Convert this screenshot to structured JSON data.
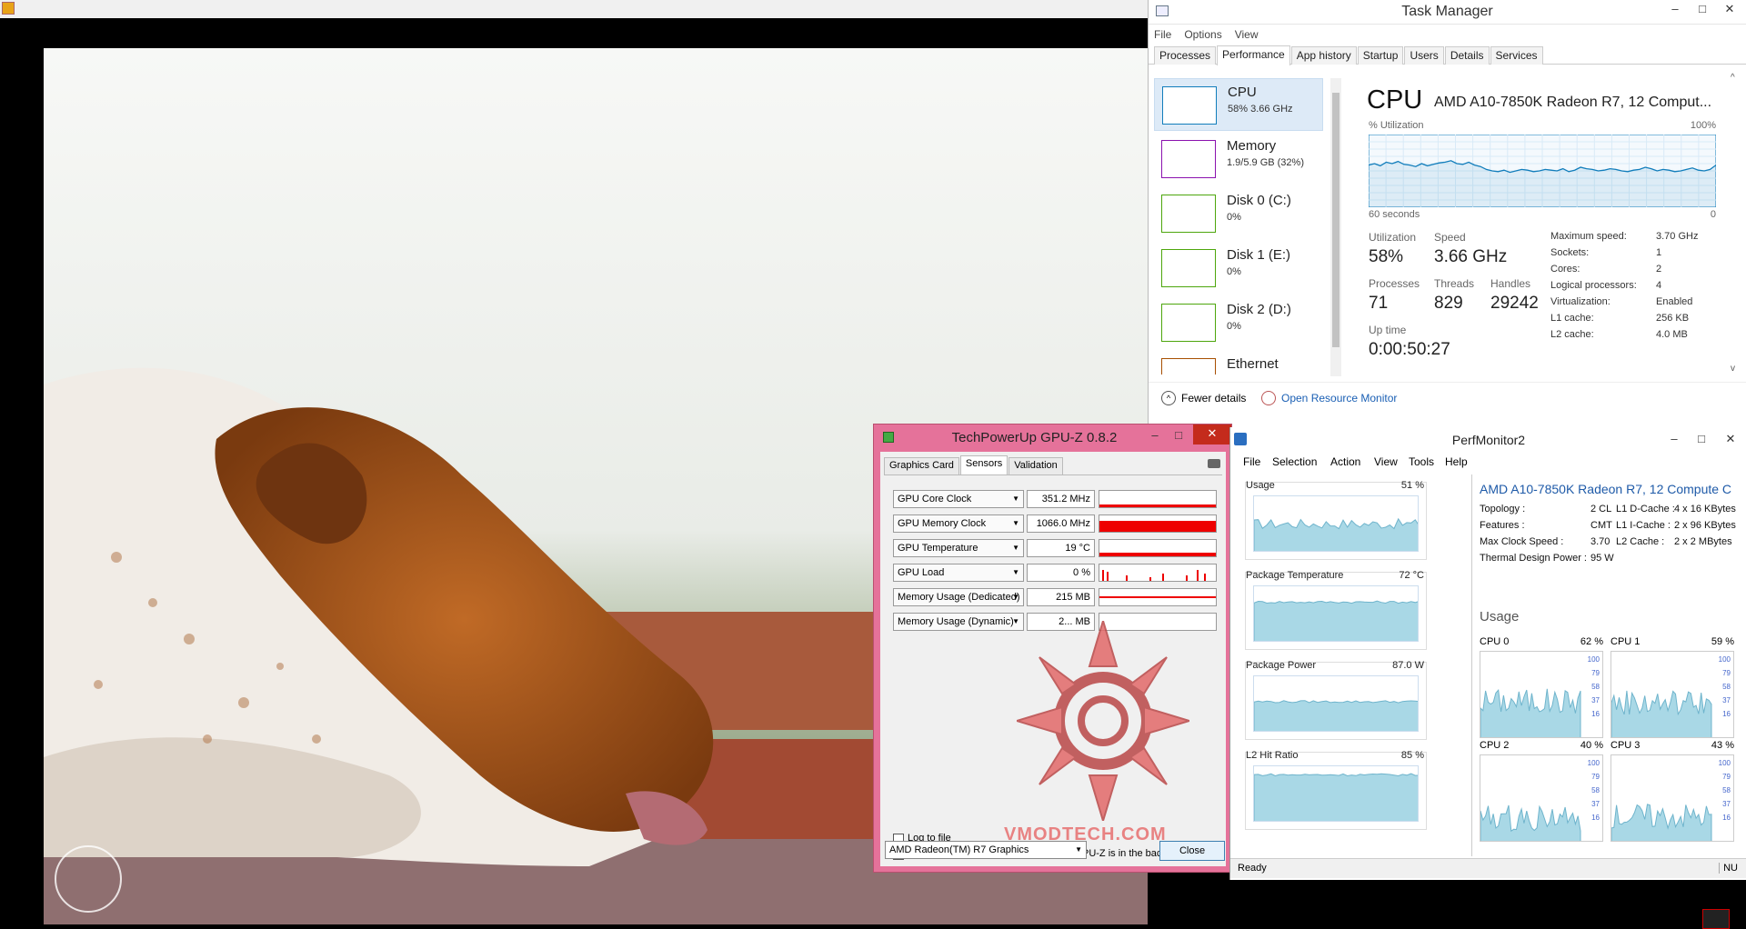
{
  "taskmgr": {
    "title": "Task Manager",
    "menu": [
      "File",
      "Options",
      "View"
    ],
    "tabs": [
      "Processes",
      "Performance",
      "App history",
      "Startup",
      "Users",
      "Details",
      "Services"
    ],
    "sidebar": [
      {
        "name": "CPU",
        "sub": "58%  3.66 GHz",
        "color": "#117dbb"
      },
      {
        "name": "Memory",
        "sub": "1.9/5.9 GB (32%)",
        "color": "#8b12ae"
      },
      {
        "name": "Disk 0 (C:)",
        "sub": "0%",
        "color": "#4da60c"
      },
      {
        "name": "Disk 1 (E:)",
        "sub": "0%",
        "color": "#4da60c"
      },
      {
        "name": "Disk 2 (D:)",
        "sub": "0%",
        "color": "#4da60c"
      },
      {
        "name": "Ethernet",
        "sub": "",
        "color": "#a74f01"
      }
    ],
    "cpu": {
      "heading": "CPU",
      "model": "AMD A10-7850K Radeon R7, 12 Comput...",
      "util_label": "% Utilization",
      "max_label": "100%",
      "seconds_label": "60 seconds",
      "zero_label": "0",
      "stats": {
        "utilization_label": "Utilization",
        "utilization": "58%",
        "speed_label": "Speed",
        "speed": "3.66 GHz",
        "processes_label": "Processes",
        "processes": "71",
        "threads_label": "Threads",
        "threads": "829",
        "handles_label": "Handles",
        "handles": "29242",
        "uptime_label": "Up time",
        "uptime": "0:00:50:27"
      },
      "specs": [
        {
          "k": "Maximum speed:",
          "v": "3.70 GHz"
        },
        {
          "k": "Sockets:",
          "v": "1"
        },
        {
          "k": "Cores:",
          "v": "2"
        },
        {
          "k": "Logical processors:",
          "v": "4"
        },
        {
          "k": "Virtualization:",
          "v": "Enabled"
        },
        {
          "k": "L1 cache:",
          "v": "256 KB"
        },
        {
          "k": "L2 cache:",
          "v": "4.0 MB"
        }
      ],
      "history": [
        58,
        60,
        57,
        62,
        60,
        63,
        59,
        58,
        56,
        60,
        57,
        59,
        61,
        62,
        64,
        60,
        59,
        62,
        58,
        56,
        52,
        50,
        49,
        51,
        48,
        50,
        52,
        51,
        49,
        50,
        52,
        51,
        50,
        53,
        49,
        51,
        55,
        53,
        52,
        50,
        51,
        53,
        52,
        50,
        49,
        51,
        52,
        55,
        53,
        50,
        52,
        51,
        49,
        50,
        52,
        54,
        51,
        50,
        52,
        58
      ]
    },
    "fewer_details": "Fewer details",
    "open_resmon": "Open Resource Monitor"
  },
  "gpuz": {
    "title": "TechPowerUp GPU-Z 0.8.2",
    "tabs": [
      "Graphics Card",
      "Sensors",
      "Validation"
    ],
    "sensors": [
      {
        "name": "GPU Core Clock",
        "value": "351.2 MHz"
      },
      {
        "name": "GPU Memory Clock",
        "value": "1066.0 MHz"
      },
      {
        "name": "GPU Temperature",
        "value": "19 °C"
      },
      {
        "name": "GPU Load",
        "value": "0 %"
      },
      {
        "name": "Memory Usage (Dedicated)",
        "value": "215 MB"
      },
      {
        "name": "Memory Usage (Dynamic)",
        "value": "2... MB"
      }
    ],
    "log_to_file": "Log to file",
    "continue_refresh": "Continue refreshing this screen while GPU-Z is in the background",
    "device": "AMD Radeon(TM) R7 Graphics",
    "close": "Close",
    "watermark": "VMODTECH.COM"
  },
  "perfmon": {
    "title": "PerfMonitor2",
    "menu": [
      "File",
      "Selection",
      "Action",
      "View",
      "Tools",
      "Help"
    ],
    "tiles": [
      {
        "label": "Usage",
        "value": "51 %",
        "level": 0.51
      },
      {
        "label": "Package Temperature",
        "value": "72 °C",
        "level": 0.72
      },
      {
        "label": "Package Power",
        "value": "87.0 W",
        "level": 0.55
      },
      {
        "label": "L2 Hit Ratio",
        "value": "85 %",
        "level": 0.85
      }
    ],
    "cpu_name": "AMD A10-7850K Radeon R7, 12 Compute C",
    "specs": [
      {
        "k": "Topology :",
        "v": "2 CL",
        "k2": "L1 D-Cache :",
        "v2": "4 x 16 KBytes"
      },
      {
        "k": "Features :",
        "v": "CMT",
        "k2": "L1 I-Cache :",
        "v2": "2 x 96 KBytes"
      },
      {
        "k": "Max Clock Speed :",
        "v": "3.70",
        "k2": "L2 Cache :",
        "v2": "2 x 2 MBytes"
      },
      {
        "k": "Thermal Design Power :",
        "v": "95 W",
        "k2": "",
        "v2": ""
      }
    ],
    "usage_heading": "Usage",
    "cores": [
      {
        "label": "CPU 0",
        "value": "62 %"
      },
      {
        "label": "CPU 1",
        "value": "59 %"
      },
      {
        "label": "CPU 2",
        "value": "40 %"
      },
      {
        "label": "CPU 3",
        "value": "43 %"
      }
    ],
    "ticks": [
      "100",
      "79",
      "58",
      "37",
      "16"
    ],
    "status": "Ready",
    "status_right": "NU"
  }
}
